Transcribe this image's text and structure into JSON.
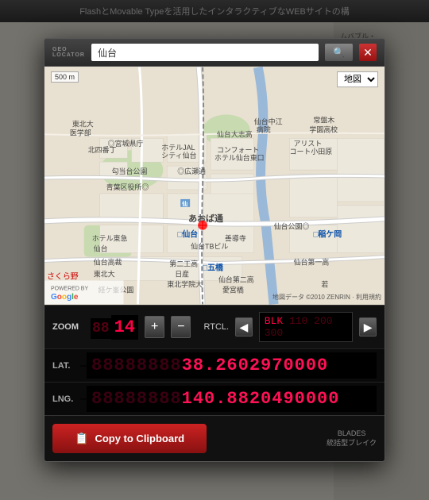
{
  "background": {
    "top_bar_text": "FlashとMovable Typeを活用したインタラクティブなWEBサイトの構"
  },
  "modal": {
    "title_line1": "GEO",
    "title_line2": "LOCATOR",
    "search_value": "仙台",
    "search_placeholder": "仙台",
    "search_button_label": "🔍",
    "close_button_label": "✕",
    "map_type_option": "地図",
    "map_scale": "500 m",
    "powered_by": "POWERED BY",
    "google_text": "Google",
    "map_attribution": "地図データ ©2010 ZENRIN · 利用規約"
  },
  "controls": {
    "zoom_label": "ZOOM",
    "zoom_value": "14",
    "zoom_dim": "88",
    "plus_label": "+",
    "minus_label": "−",
    "rtcl_label": "RTCL.",
    "rtcl_prev_label": "◀",
    "rtcl_next_label": "▶",
    "rtcl_value": "BLK",
    "rtcl_coords": "110 200 300",
    "lat_label": "LAT.",
    "lat_dim": "88888888",
    "lat_value": "38.2602970000",
    "lng_label": "LNG.",
    "lng_dim": "88888888",
    "lng_value": "140.8820490000"
  },
  "footer": {
    "copy_icon": "📋",
    "copy_label": "Copy to Clipboard",
    "blades_line1": "BLADES",
    "blades_line2": "統括型ブレイク"
  }
}
